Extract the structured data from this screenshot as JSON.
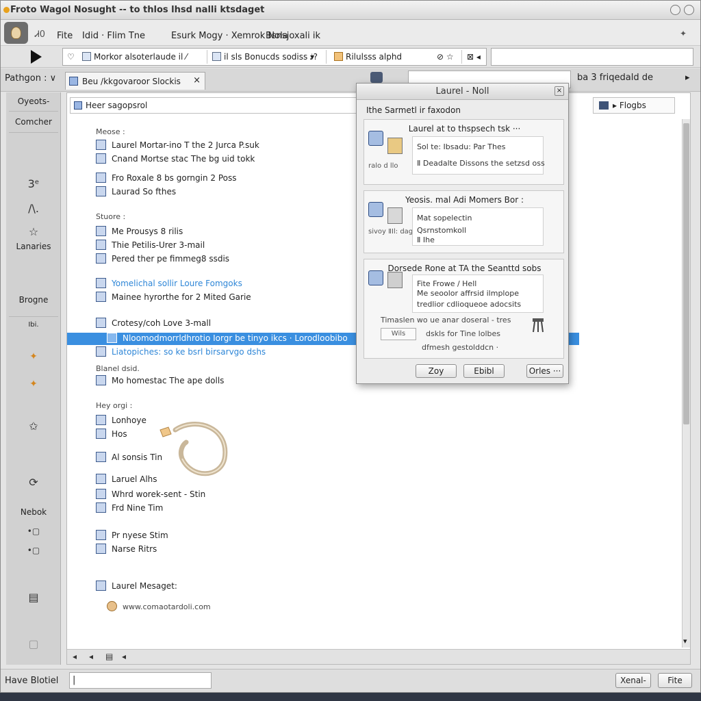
{
  "window": {
    "title": "Froto Wagol Nosught -- to thlos lhsd nalli ktsdaget"
  },
  "menubar": {
    "items": [
      "Fite",
      "Idid · Flim Tne",
      "Esurk Mogy · Xemrok Nola",
      "Bsnsjoxali ik"
    ],
    "left_icon": "Ꮧ0",
    "pin_glyph": "✦"
  },
  "toolbar": {
    "address_segments": [
      "♡",
      "Morkor alsoterlaude il ⁄",
      "il sls Bonucds sodiss ▾",
      "♩?",
      "Rilulsss alphd",
      "⊘ ☆",
      "⊠ ◂"
    ]
  },
  "tabrow": {
    "left_label": "Pathgon : ∨",
    "tab_label": "Beu /kkgovaroor Slockis",
    "tab_close": "×",
    "right_label": "ba 3 friqedald de",
    "right_glyph": "▸"
  },
  "sidebar": {
    "items": [
      {
        "label": "Oyeots-",
        "kind": "text"
      },
      {
        "label": "Comcher",
        "kind": "text"
      },
      {
        "label": "3ᵉ",
        "kind": "glyph"
      },
      {
        "label": "∕\\.",
        "kind": "glyph"
      },
      {
        "label": "☆",
        "kind": "glyph"
      },
      {
        "label": "Lanaries",
        "kind": "text"
      },
      {
        "label": "Brogne",
        "kind": "text"
      },
      {
        "label": "Ibi.",
        "kind": "text"
      },
      {
        "label": "✦",
        "kind": "orange"
      },
      {
        "label": "✦",
        "kind": "orange"
      },
      {
        "label": "✩",
        "kind": "glyph"
      },
      {
        "label": "⟳",
        "kind": "glyph"
      },
      {
        "label": "Nebok",
        "kind": "text"
      },
      {
        "label": "•▢",
        "kind": "glyph"
      },
      {
        "label": "•▢",
        "kind": "glyph"
      },
      {
        "label": "▤",
        "kind": "glyph"
      },
      {
        "label": "▢",
        "kind": "glyph"
      }
    ]
  },
  "main": {
    "header_label": "Heer sagopsrol",
    "right_field_label": "▸ Flogbs",
    "sections": [
      {
        "head": "Meose :",
        "rows": [
          {
            "label": "Laurel Mortar-ino T the 2 Jurca P.suk",
            "style": "normal"
          },
          {
            "label": "Cnand Mortse stac The bg uid tokk",
            "style": "normal"
          }
        ]
      },
      {
        "head": "",
        "rows": [
          {
            "label": "Fro Roxale 8 bs gorngin 2 Poss",
            "style": "normal"
          },
          {
            "label": "Laurad So fthes",
            "style": "normal"
          }
        ]
      },
      {
        "head": "Stuore :",
        "rows": [
          {
            "label": "Me Prousys 8 rilis",
            "style": "normal"
          },
          {
            "label": "Thie Petilis-Urer 3-mail",
            "style": "normal"
          },
          {
            "label": "Pered ther pe fimmeg8 ssdis",
            "style": "normal"
          }
        ]
      },
      {
        "head": "",
        "rows": [
          {
            "label": "Yomelichal sollir Loure Fomgoks",
            "style": "link"
          },
          {
            "label": "Mainee hyrorthe for 2 Mited Garie",
            "style": "normal"
          }
        ]
      },
      {
        "head": "",
        "rows": [
          {
            "label": "Crotesy/coh Love 3-mall",
            "style": "normal"
          },
          {
            "label": "Nloomodmorrldhrotio Iorgr be tinyo ikcs · Lorodloobibo",
            "style": "selected"
          },
          {
            "label": "Liatopiches: so ke bsrl birsarvgo dshs",
            "style": "link"
          }
        ]
      },
      {
        "head": "Blanel dsid.",
        "rows": [
          {
            "label": "Mo homestac The ape dolls",
            "style": "normal"
          }
        ]
      },
      {
        "head": "Hey orgi :",
        "rows": [
          {
            "label": "Lonhoye",
            "style": "normal"
          },
          {
            "label": "Hos",
            "style": "normal"
          },
          {
            "label": "Al sonsis Tin",
            "style": "normal"
          },
          {
            "label": "Laruel Alhs",
            "style": "normal"
          },
          {
            "label": "Whrd worek-sent - Stin",
            "style": "normal"
          },
          {
            "label": "Frd Nine Tim",
            "style": "normal"
          },
          {
            "label": "Pr nyese Stim",
            "style": "normal"
          },
          {
            "label": "Narse Ritrs",
            "style": "normal"
          },
          {
            "label": "Laurel Mesaget:",
            "style": "normal"
          },
          {
            "label": "www.comaotardoli.com",
            "style": "normal"
          }
        ]
      }
    ],
    "hscroll_controls": [
      "◂",
      "◂",
      "▤",
      "◂"
    ],
    "vscroll_down": "▾"
  },
  "dialog": {
    "title": "Laurel - Noll",
    "subtitle": "Ithe Sarmetl ir faxodon",
    "panels": [
      {
        "heading": "Laurel at to thspsech tsk ···",
        "box_lines": [
          "Sol te: Ibsadu: Par Thes",
          "Ⅱ Deadalte Dissons the setzsd oss"
        ],
        "side_text": "ralo d llo"
      },
      {
        "heading": "Yeosis. mal Adi Momers Bor :",
        "box_lines": [
          "Mat sopelectin",
          "Qsrnstomkoll",
          "Ⅱ Ihe"
        ],
        "side_text": "sivoy ⅡIl: dage lu"
      },
      {
        "heading": "Dorsede Rone at TA the Seanttd sobs",
        "box_lines": [
          "Fite Frowe / Hell",
          "Me seoolor affrsid ilmplope",
          "tredlior cdlioqueoe adocsits"
        ],
        "footer_lines": [
          "Timaslen wo ue anar doseral - tres",
          "dskls for Tine lolbes",
          "dfmesh gestolddcn ·"
        ],
        "small_field": "Wils"
      }
    ],
    "buttons": [
      "Zoy",
      "Ebibl",
      "Orles ···"
    ]
  },
  "statusbar": {
    "label": "Have Blotiel",
    "input_value": "|",
    "buttons": [
      "Xenal-",
      "Fite"
    ]
  }
}
